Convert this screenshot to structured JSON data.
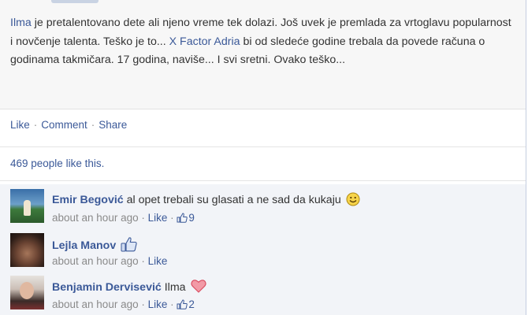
{
  "post": {
    "text_parts": {
      "mention": "Ilma",
      "text1": " je pretalentovano dete ali njeno vreme tek dolazi. Još uvek je premlada za vrtoglavu popularnost i novčenje talenta. Teško je to... ",
      "link": "X Factor Adria",
      "text2": " bi od sledeće godine trebala da povede računa o godinama takmičara. 17 godina, naviše... I svi sretni. Ovako teško..."
    }
  },
  "actions": {
    "like": "Like",
    "comment": "Comment",
    "share": "Share",
    "separator": "·"
  },
  "likes_summary": "469 people like this.",
  "comments": [
    {
      "name": "Emir Begović",
      "text": " al opet trebali su glasati a ne sad da kukaju",
      "emoticon": "smiley-icon",
      "time": "about an hour ago",
      "like_label": "Like",
      "like_count": "9"
    },
    {
      "name": "Lejla Manov",
      "text": "",
      "emoticon": "thumbs-up-icon",
      "time": "about an hour ago",
      "like_label": "Like",
      "like_count": ""
    },
    {
      "name": "Benjamin Dervisević",
      "text": " Ilma",
      "emoticon": "heart-icon",
      "time": "about an hour ago",
      "like_label": "Like",
      "like_count": "2"
    }
  ],
  "colors": {
    "link": "#3b5998",
    "meta": "#8a8a8a",
    "comment_bg": "#f2f4f8",
    "heart": "#e05a6a"
  }
}
